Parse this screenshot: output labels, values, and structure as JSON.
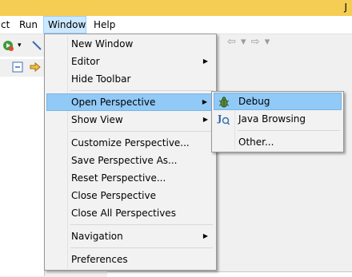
{
  "title_fragment": "J",
  "menubar": {
    "items": [
      {
        "label": "ct"
      },
      {
        "label": "Run"
      },
      {
        "label": "Window"
      },
      {
        "label": "Help"
      }
    ]
  },
  "toolbar": {
    "nav_arrows": "⇦ ▾ ⇨ ▾"
  },
  "window_menu": {
    "items": [
      {
        "label": "New Window"
      },
      {
        "label": "Editor",
        "arrow": "▶"
      },
      {
        "label": "Hide Toolbar"
      },
      {
        "label": "Open Perspective",
        "arrow": "▶"
      },
      {
        "label": "Show View",
        "arrow": "▶"
      },
      {
        "label": "Customize Perspective..."
      },
      {
        "label": "Save Perspective As..."
      },
      {
        "label": "Reset Perspective..."
      },
      {
        "label": "Close Perspective"
      },
      {
        "label": "Close All Perspectives"
      },
      {
        "label": "Navigation",
        "arrow": "▶"
      },
      {
        "label": "Preferences"
      }
    ]
  },
  "perspective_menu": {
    "items": [
      {
        "label": "Debug",
        "icon": "debug-bug-icon"
      },
      {
        "label": "Java Browsing",
        "icon": "java-browsing-icon"
      },
      {
        "label": "Other..."
      }
    ]
  },
  "colors": {
    "title_bar": "#f5cd53",
    "menu_highlight": "#91c9f7",
    "menubar_open": "#cce8ff"
  }
}
